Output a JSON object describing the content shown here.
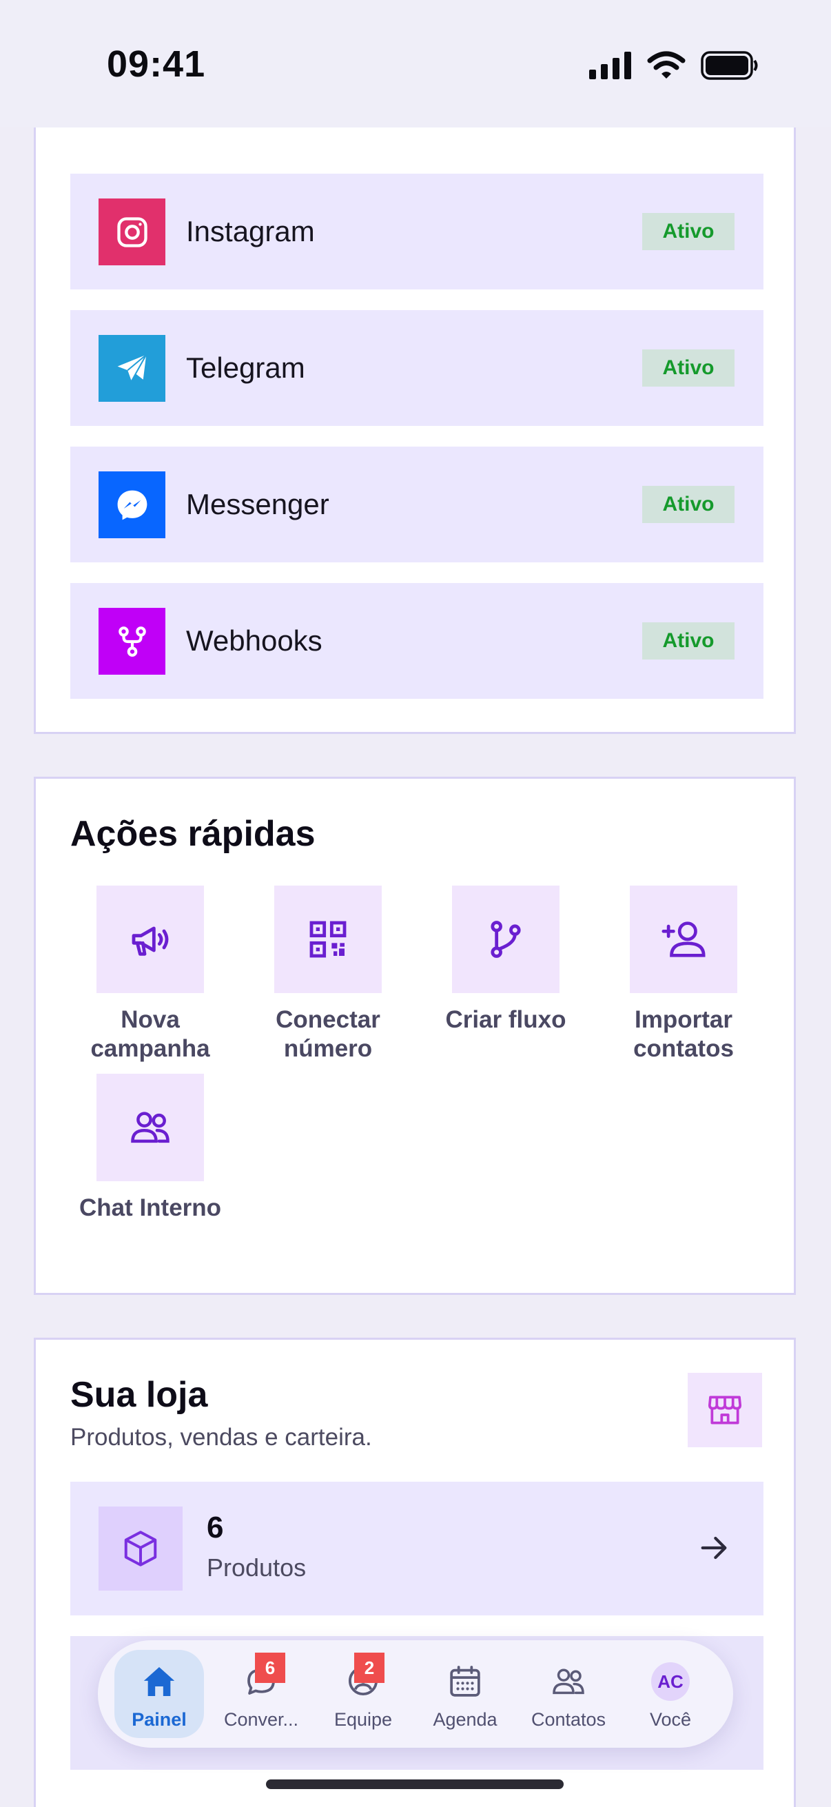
{
  "status": {
    "time": "09:41"
  },
  "channels": [
    {
      "name": "Instagram",
      "status": "Ativo",
      "icon": "instagram-icon",
      "color": "#e1306c"
    },
    {
      "name": "Telegram",
      "status": "Ativo",
      "icon": "telegram-icon",
      "color": "#229ed9"
    },
    {
      "name": "Messenger",
      "status": "Ativo",
      "icon": "messenger-icon",
      "color": "#0866ff"
    },
    {
      "name": "Webhooks",
      "status": "Ativo",
      "icon": "webhook-icon",
      "color": "#c000f7"
    }
  ],
  "quick_actions": {
    "title": "Ações rápidas",
    "items": [
      {
        "line1": "Nova",
        "line2": "campanha",
        "icon": "megaphone-icon"
      },
      {
        "line1": "Conectar",
        "line2": "número",
        "icon": "qr-code-icon"
      },
      {
        "line1": "Criar fluxo",
        "line2": "",
        "icon": "flow-branch-icon"
      },
      {
        "line1": "Importar",
        "line2": "contatos",
        "icon": "user-plus-icon"
      },
      {
        "line1": "Chat Interno",
        "line2": "",
        "icon": "team-chat-icon"
      }
    ]
  },
  "store": {
    "title": "Sua loja",
    "subtitle": "Produtos, vendas e carteira.",
    "products": {
      "count": "6",
      "label": "Produtos"
    }
  },
  "tabs": [
    {
      "label": "Painel",
      "icon": "home-icon",
      "active": true
    },
    {
      "label": "Conver...",
      "icon": "chat-icon",
      "badge": "6"
    },
    {
      "label": "Equipe",
      "icon": "team-icon",
      "badge": "2"
    },
    {
      "label": "Agenda",
      "icon": "calendar-icon"
    },
    {
      "label": "Contatos",
      "icon": "contacts-icon"
    },
    {
      "label": "Você",
      "icon": "avatar",
      "avatar_initials": "AC"
    }
  ],
  "colors": {
    "accent": "#6a1fd0",
    "active_tab": "#1b68d3",
    "badge": "#ef4d4d",
    "status_ok": "#159a2c"
  }
}
